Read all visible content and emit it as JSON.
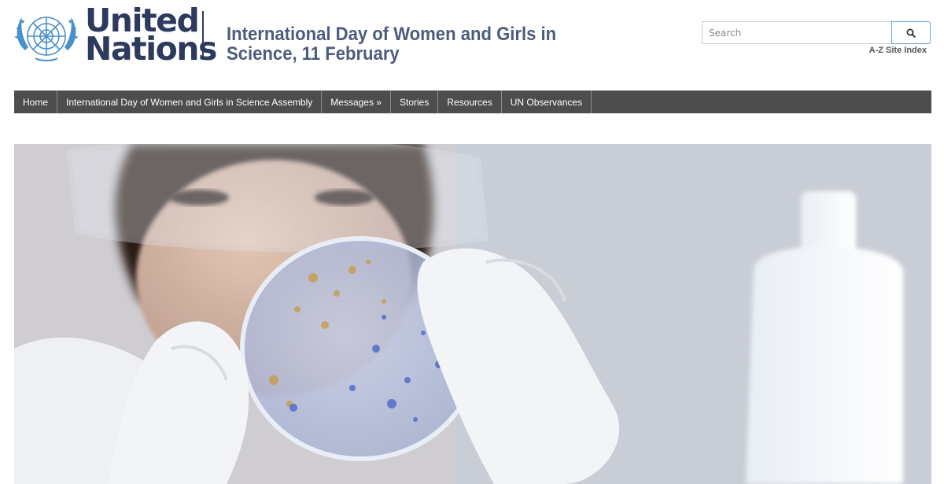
{
  "header": {
    "brand_line1": "United",
    "brand_line2": "Nations",
    "page_title": "International Day of Women and Girls in Science, 11 February"
  },
  "search": {
    "placeholder": "Search",
    "icon": "search-icon",
    "az_index_label": "A-Z Site Index"
  },
  "nav": {
    "items": [
      {
        "label": "Home"
      },
      {
        "label": "International Day of Women and Girls in Science Assembly"
      },
      {
        "label": "Messages »"
      },
      {
        "label": "Stories"
      },
      {
        "label": "Resources"
      },
      {
        "label": "UN Observances"
      }
    ]
  },
  "hero": {
    "image": "scientist-with-petri-dish"
  },
  "colors": {
    "brand_navy": "#2d3a5e",
    "nav_background": "#4d4d4d",
    "search_accent": "#6ba3d6"
  }
}
